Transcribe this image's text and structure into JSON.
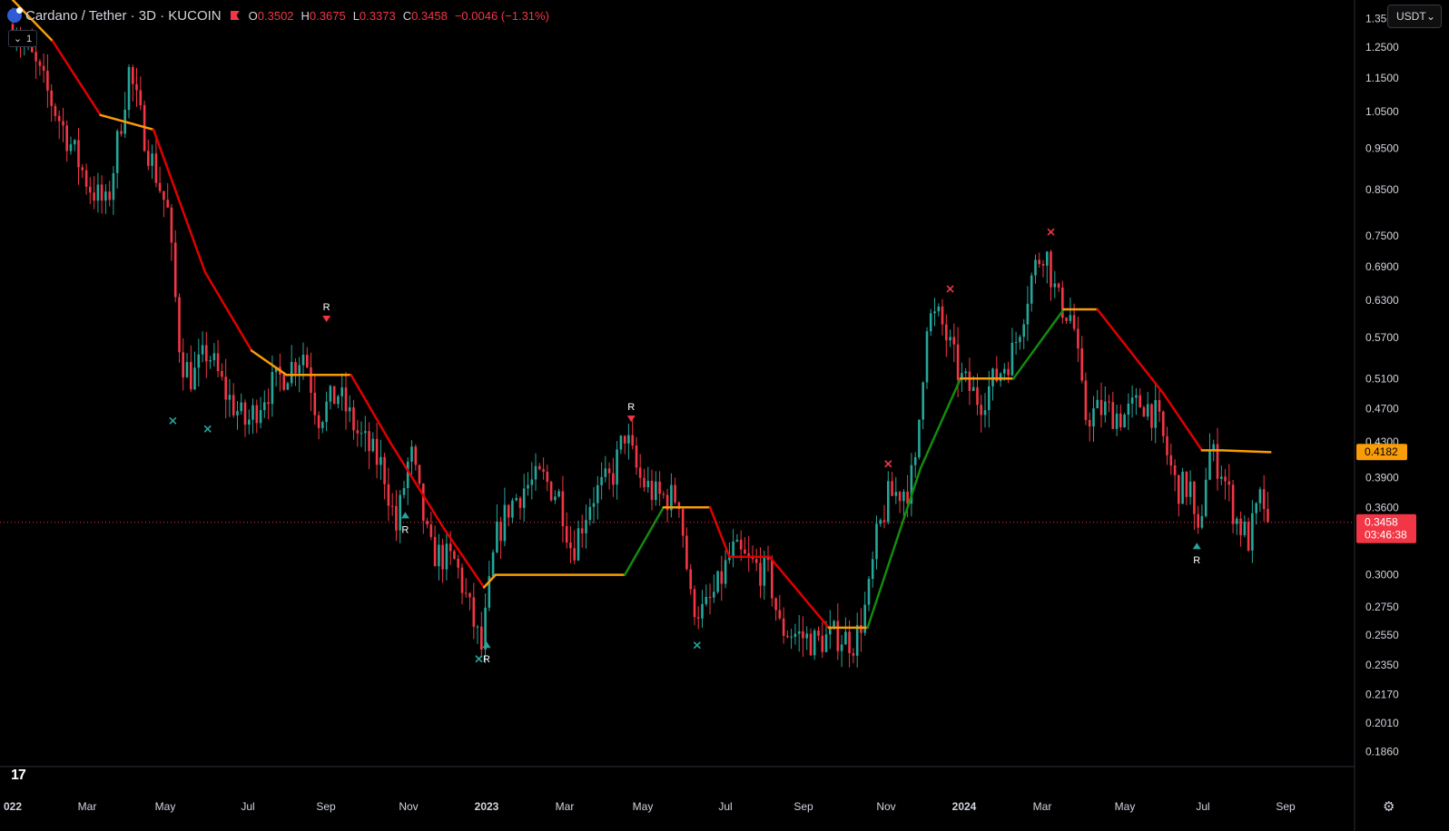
{
  "header": {
    "title": "Cardano / Tether · 3D · KUCOIN",
    "o_label": "O",
    "o_value": "0.3502",
    "h_label": "H",
    "h_value": "0.3675",
    "l_label": "L",
    "l_value": "0.3373",
    "c_label": "C",
    "c_value": "0.3458",
    "change": "−0.0046 (−1.31%)",
    "indicator_count": "1"
  },
  "currency_selector": {
    "value": "USDT",
    "chevron": "chevron-down-icon"
  },
  "time_axis_labels": [
    {
      "label": "022",
      "bold": true
    },
    {
      "label": "Mar"
    },
    {
      "label": "May"
    },
    {
      "label": "Jul"
    },
    {
      "label": "Sep"
    },
    {
      "label": "Nov"
    },
    {
      "label": "2023",
      "bold": true
    },
    {
      "label": "Mar"
    },
    {
      "label": "May"
    },
    {
      "label": "Jul"
    },
    {
      "label": "Sep"
    },
    {
      "label": "Nov"
    },
    {
      "label": "2024",
      "bold": true
    },
    {
      "label": "Mar"
    },
    {
      "label": "May"
    },
    {
      "label": "Jul"
    },
    {
      "label": "Sep"
    }
  ],
  "price_badges": {
    "trail": {
      "value": "0.4182",
      "color": "#f89c07"
    },
    "last": {
      "value": "0.3458",
      "countdown": "03:46:38",
      "color": "#f23645"
    }
  },
  "chart_data": {
    "type": "candlestick",
    "symbol": "Cardano / Tether",
    "interval": "3D",
    "exchange": "KUCOIN",
    "y_scale": "log",
    "ylim": [
      0.1786,
      1.4195
    ],
    "y_ticks": [
      1.35,
      1.25,
      1.15,
      1.05,
      0.95,
      0.85,
      0.75,
      0.69,
      0.63,
      0.57,
      0.51,
      0.47,
      0.43,
      0.39,
      0.36,
      0.3,
      0.275,
      0.255,
      0.235,
      0.217,
      0.201,
      0.186
    ],
    "y_tick_labels": [
      "1.3500",
      "1.2500",
      "1.1500",
      "1.0500",
      "0.9500",
      "0.8500",
      "0.7500",
      "0.6900",
      "0.6300",
      "0.5700",
      "0.5100",
      "0.4700",
      "0.4300",
      "0.3900",
      "0.3600",
      "0.3000",
      "0.2750",
      "0.2550",
      "0.2350",
      "0.2170",
      "0.2010",
      "0.1860"
    ],
    "x_range": [
      "2022-01-01",
      "2024-09-05"
    ],
    "price_path": [
      [
        "2022-01-01",
        1.33
      ],
      [
        "2022-01-15",
        1.22
      ],
      [
        "2022-02-01",
        1.07
      ],
      [
        "2022-02-15",
        0.96
      ],
      [
        "2022-03-01",
        0.86
      ],
      [
        "2022-03-15",
        0.81
      ],
      [
        "2022-04-01",
        1.17
      ],
      [
        "2022-04-15",
        0.96
      ],
      [
        "2022-05-01",
        0.8
      ],
      [
        "2022-05-11",
        0.54
      ],
      [
        "2022-05-20",
        0.51
      ],
      [
        "2022-06-01",
        0.55
      ],
      [
        "2022-06-15",
        0.49
      ],
      [
        "2022-07-01",
        0.45
      ],
      [
        "2022-07-15",
        0.49
      ],
      [
        "2022-08-01",
        0.52
      ],
      [
        "2022-08-15",
        0.55
      ],
      [
        "2022-08-25",
        0.46
      ],
      [
        "2022-09-10",
        0.49
      ],
      [
        "2022-09-25",
        0.44
      ],
      [
        "2022-10-15",
        0.4
      ],
      [
        "2022-10-25",
        0.34
      ],
      [
        "2022-11-05",
        0.42
      ],
      [
        "2022-11-20",
        0.32
      ],
      [
        "2022-12-10",
        0.31
      ],
      [
        "2022-12-30",
        0.245
      ],
      [
        "2023-01-10",
        0.33
      ],
      [
        "2023-01-20",
        0.36
      ],
      [
        "2023-02-01",
        0.38
      ],
      [
        "2023-02-15",
        0.39
      ],
      [
        "2023-03-01",
        0.37
      ],
      [
        "2023-03-10",
        0.32
      ],
      [
        "2023-03-25",
        0.37
      ],
      [
        "2023-04-10",
        0.39
      ],
      [
        "2023-04-20",
        0.44
      ],
      [
        "2023-05-01",
        0.39
      ],
      [
        "2023-05-15",
        0.37
      ],
      [
        "2023-06-01",
        0.37
      ],
      [
        "2023-06-10",
        0.28
      ],
      [
        "2023-06-20",
        0.27
      ],
      [
        "2023-07-01",
        0.29
      ],
      [
        "2023-07-12",
        0.32
      ],
      [
        "2023-07-25",
        0.31
      ],
      [
        "2023-08-10",
        0.3
      ],
      [
        "2023-08-18",
        0.26
      ],
      [
        "2023-09-01",
        0.255
      ],
      [
        "2023-09-15",
        0.25
      ],
      [
        "2023-10-01",
        0.255
      ],
      [
        "2023-10-15",
        0.25
      ],
      [
        "2023-10-25",
        0.28
      ],
      [
        "2023-11-01",
        0.33
      ],
      [
        "2023-11-10",
        0.37
      ],
      [
        "2023-11-25",
        0.38
      ],
      [
        "2023-12-01",
        0.4
      ],
      [
        "2023-12-10",
        0.6
      ],
      [
        "2023-12-20",
        0.6
      ],
      [
        "2024-01-05",
        0.51
      ],
      [
        "2024-01-20",
        0.48
      ],
      [
        "2024-02-01",
        0.51
      ],
      [
        "2024-02-15",
        0.55
      ],
      [
        "2024-03-01",
        0.68
      ],
      [
        "2024-03-10",
        0.73
      ],
      [
        "2024-03-20",
        0.63
      ],
      [
        "2024-04-01",
        0.6
      ],
      [
        "2024-04-10",
        0.46
      ],
      [
        "2024-04-25",
        0.47
      ],
      [
        "2024-05-10",
        0.46
      ],
      [
        "2024-05-25",
        0.48
      ],
      [
        "2024-06-05",
        0.46
      ],
      [
        "2024-06-20",
        0.38
      ],
      [
        "2024-07-01",
        0.38
      ],
      [
        "2024-07-06",
        0.32
      ],
      [
        "2024-07-15",
        0.42
      ],
      [
        "2024-07-25",
        0.4
      ],
      [
        "2024-08-05",
        0.35
      ],
      [
        "2024-08-15",
        0.33
      ],
      [
        "2024-08-25",
        0.37
      ],
      [
        "2024-09-01",
        0.3458
      ]
    ],
    "trail_line": [
      [
        "2022-01-01",
        1.42,
        "red"
      ],
      [
        "2022-02-01",
        1.27,
        "orange"
      ],
      [
        "2022-03-10",
        1.04,
        "red"
      ],
      [
        "2022-04-20",
        1.0,
        "orange"
      ],
      [
        "2022-05-30",
        0.68,
        "red"
      ],
      [
        "2022-07-05",
        0.55,
        "red"
      ],
      [
        "2022-08-01",
        0.515,
        "orange"
      ],
      [
        "2022-09-20",
        0.515,
        "orange"
      ],
      [
        "2022-10-20",
        0.43,
        "red"
      ],
      [
        "2022-12-01",
        0.34,
        "red"
      ],
      [
        "2023-01-01",
        0.29,
        "red"
      ],
      [
        "2023-01-10",
        0.3,
        "orange"
      ],
      [
        "2023-04-20",
        0.3,
        "orange"
      ],
      [
        "2023-05-20",
        0.36,
        "green"
      ],
      [
        "2023-06-25",
        0.36,
        "orange"
      ],
      [
        "2023-07-10",
        0.315,
        "red"
      ],
      [
        "2023-08-10",
        0.315,
        "red"
      ],
      [
        "2023-09-25",
        0.26,
        "red"
      ],
      [
        "2023-10-25",
        0.26,
        "orange"
      ],
      [
        "2023-12-05",
        0.4,
        "green"
      ],
      [
        "2024-01-05",
        0.51,
        "green"
      ],
      [
        "2024-02-15",
        0.51,
        "orange"
      ],
      [
        "2024-03-25",
        0.615,
        "green"
      ],
      [
        "2024-04-20",
        0.615,
        "orange"
      ],
      [
        "2024-06-10",
        0.49,
        "red"
      ],
      [
        "2024-07-10",
        0.42,
        "red"
      ],
      [
        "2024-07-25",
        0.42,
        "orange"
      ],
      [
        "2024-09-01",
        0.418,
        "orange"
      ]
    ],
    "last_price": 0.3458,
    "markers": [
      {
        "date": "2022-05-05",
        "price": 0.455,
        "shape": "x",
        "color": "#26a69a"
      },
      {
        "date": "2022-06-01",
        "price": 0.445,
        "shape": "x",
        "color": "#26a69a"
      },
      {
        "date": "2022-09-01",
        "price": 0.6,
        "shape": "triangle-down",
        "color": "#f23645",
        "label": "R"
      },
      {
        "date": "2022-11-01",
        "price": 0.352,
        "shape": "triangle-up",
        "color": "#26a69a",
        "label": "R"
      },
      {
        "date": "2022-12-28",
        "price": 0.239,
        "shape": "x",
        "color": "#26a69a"
      },
      {
        "date": "2023-01-03",
        "price": 0.248,
        "shape": "triangle-up",
        "color": "#26a69a",
        "label": "R"
      },
      {
        "date": "2023-04-25",
        "price": 0.458,
        "shape": "triangle-down",
        "color": "#f23645",
        "label": "R"
      },
      {
        "date": "2023-06-15",
        "price": 0.248,
        "shape": "x",
        "color": "#26a69a"
      },
      {
        "date": "2023-11-10",
        "price": 0.405,
        "shape": "x",
        "color": "#f23645"
      },
      {
        "date": "2023-12-28",
        "price": 0.65,
        "shape": "x",
        "color": "#f23645"
      },
      {
        "date": "2024-03-15",
        "price": 0.758,
        "shape": "x",
        "color": "#f23645"
      },
      {
        "date": "2024-07-06",
        "price": 0.324,
        "shape": "triangle-up",
        "color": "#26a69a",
        "label": "R"
      }
    ]
  },
  "colors": {
    "background": "#000000",
    "up": "#26a69a",
    "down": "#f23645",
    "trail_red": "#e00000",
    "trail_green": "#138a0e",
    "trail_orange": "#f89c07"
  },
  "tv_logo": "17",
  "settings_icon": "gear-icon"
}
